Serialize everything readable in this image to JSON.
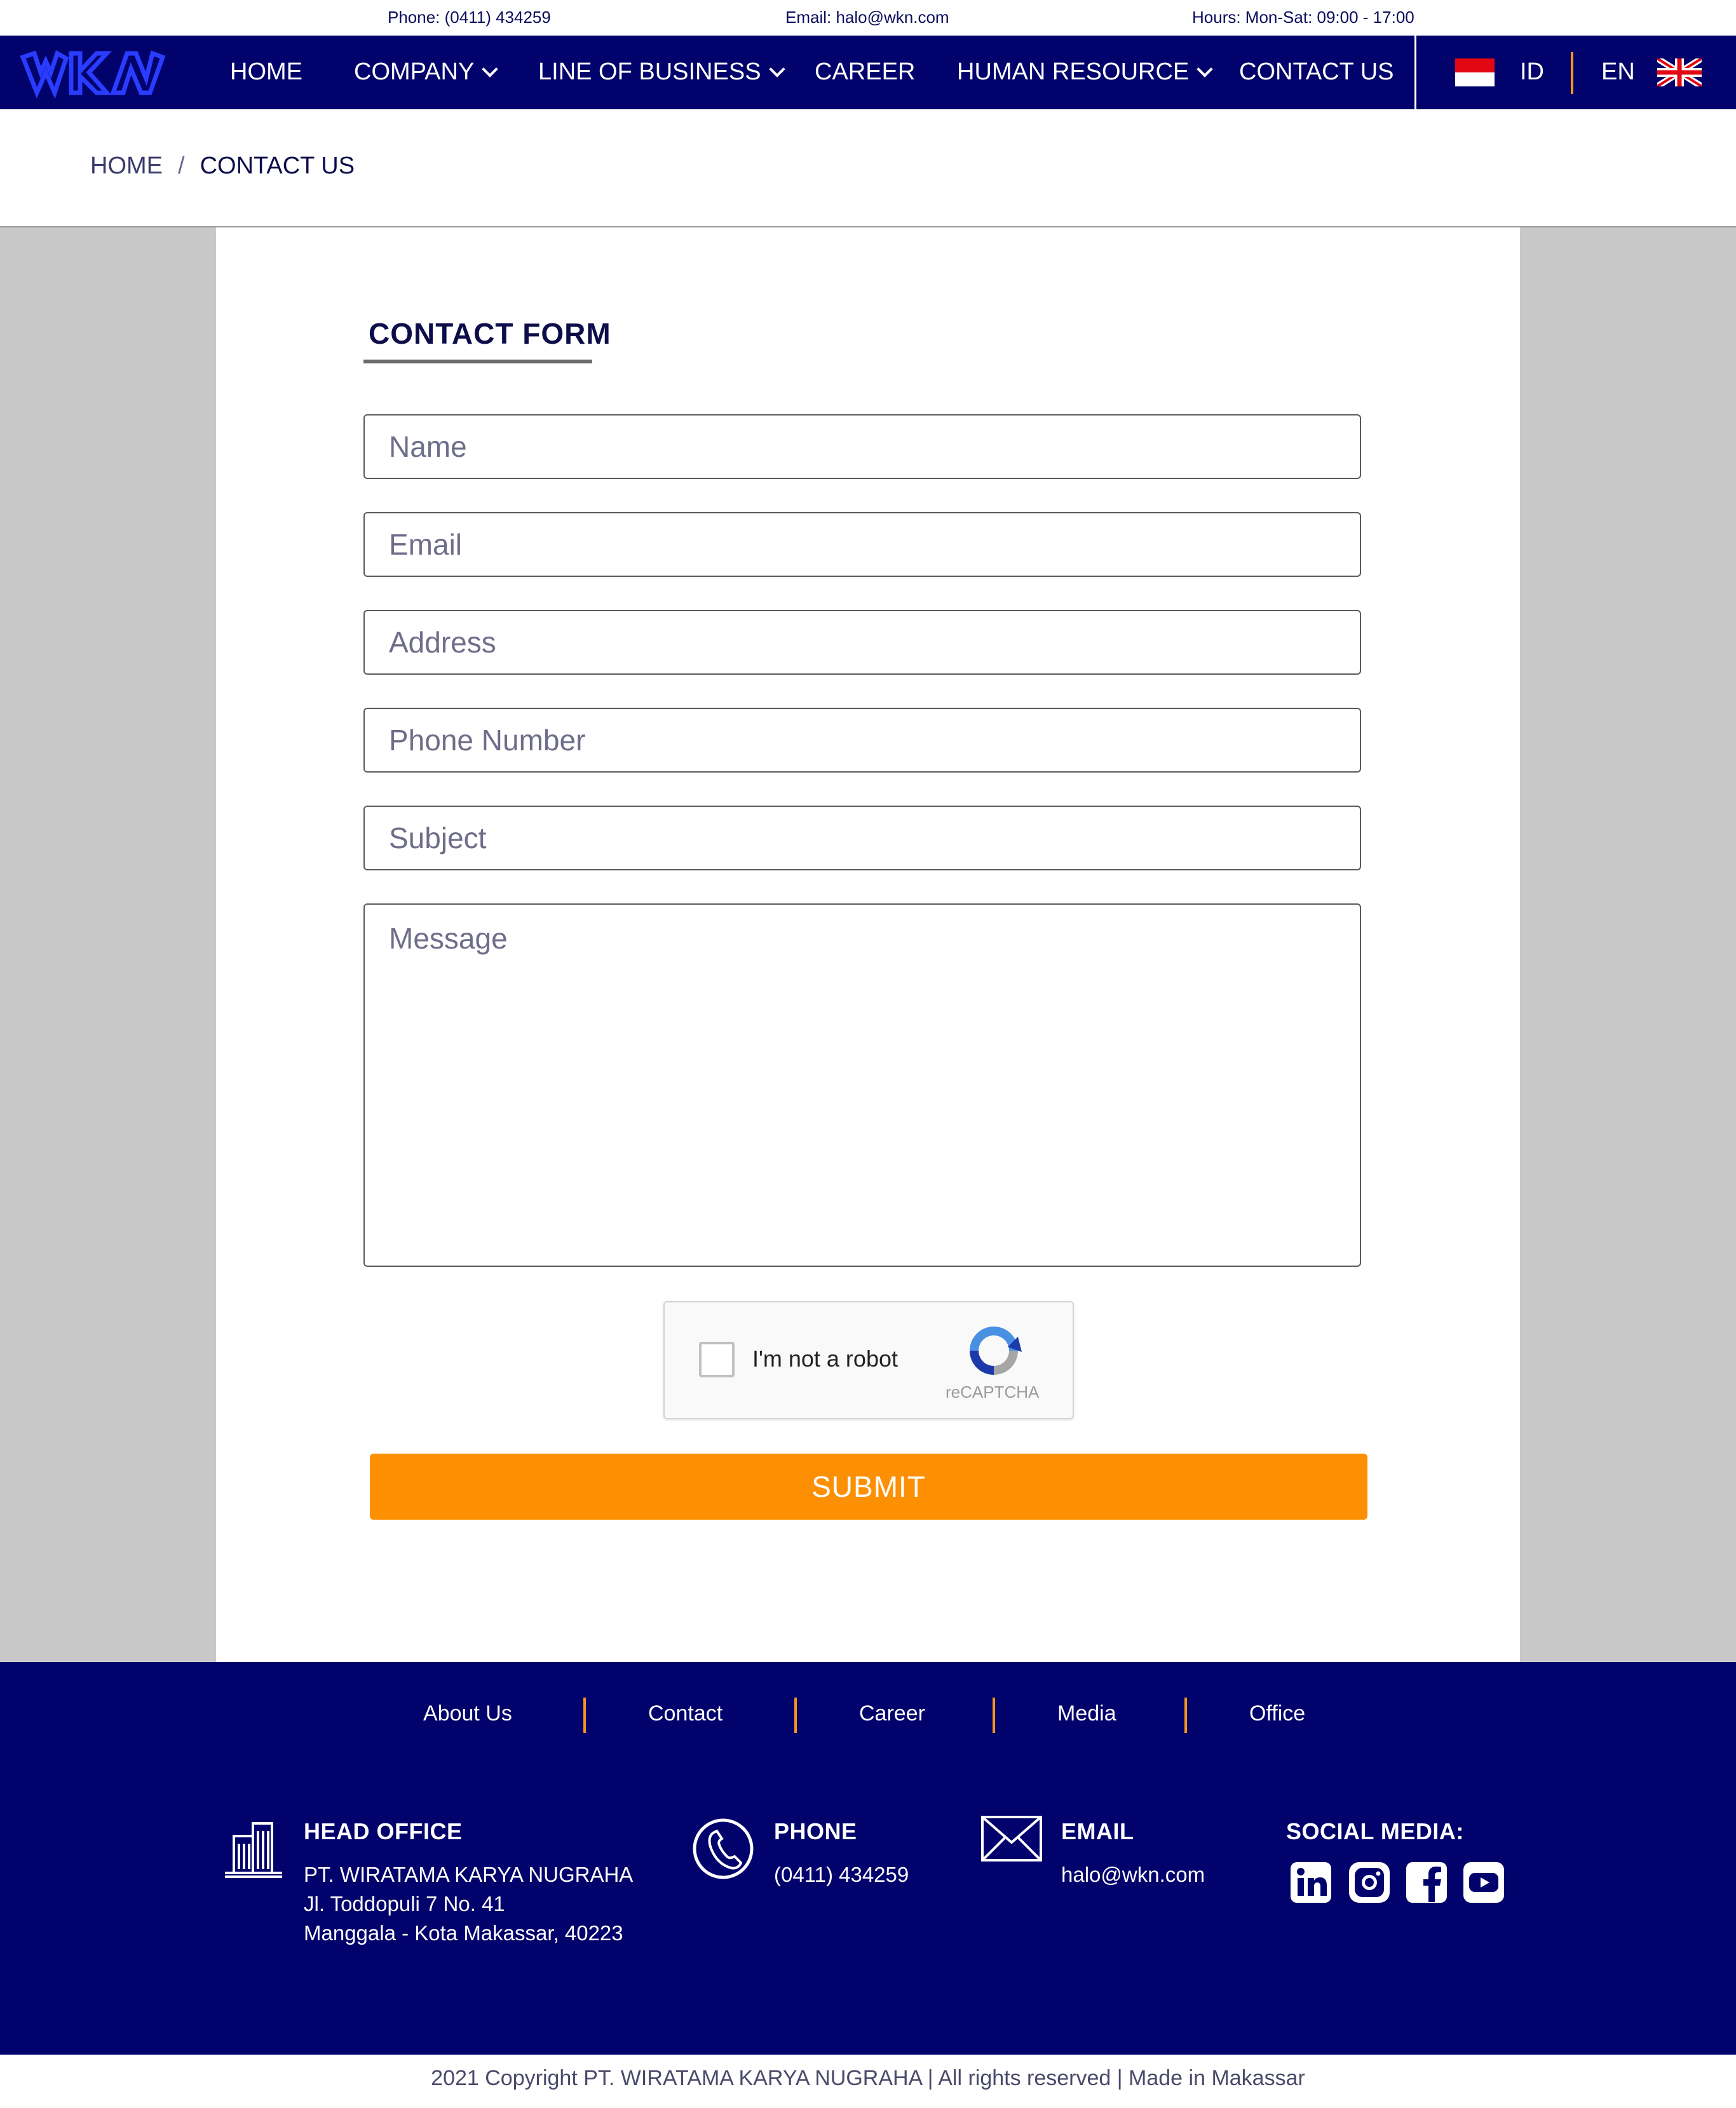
{
  "topbar": {
    "phone": "Phone: (0411) 434259",
    "email": "Email: halo@wkn.com",
    "hours": "Hours: Mon-Sat: 09:00 - 17:00"
  },
  "nav": {
    "items": [
      "HOME",
      "COMPANY",
      "LINE OF BUSINESS",
      "CAREER",
      "HUMAN RESOURCE",
      "CONTACT US"
    ],
    "lang_id": "ID",
    "lang_en": "EN"
  },
  "breadcrumb": {
    "home": "HOME",
    "separator": "/",
    "current": "CONTACT US"
  },
  "form": {
    "title": "CONTACT FORM",
    "name_placeholder": "Name",
    "email_placeholder": "Email",
    "address_placeholder": "Address",
    "phone_placeholder": "Phone Number",
    "subject_placeholder": "Subject",
    "message_placeholder": "Message",
    "captcha_label": "I'm not a robot",
    "captcha_brand": "reCAPTCHA",
    "submit_label": "SUBMIT"
  },
  "footer": {
    "links": [
      "About Us",
      "Contact",
      "Career",
      "Media",
      "Office"
    ],
    "head_office": {
      "title": "HEAD OFFICE",
      "line1": "PT. WIRATAMA KARYA NUGRAHA",
      "line2": "Jl. Toddopuli 7 No. 41",
      "line3": "Manggala - Kota Makassar, 40223"
    },
    "phone": {
      "title": "PHONE",
      "value": "(0411) 434259"
    },
    "email": {
      "title": "EMAIL",
      "value": "halo@wkn.com"
    },
    "social": {
      "title": "SOCIAL MEDIA:",
      "icons": [
        "linkedin-icon",
        "instagram-icon",
        "facebook-icon",
        "youtube-icon"
      ]
    }
  },
  "copyright": "2021 Copyright PT. WIRATAMA KARYA NUGRAHA |  All rights reserved | Made in Makassar",
  "colors": {
    "navy": "#01026b",
    "accent": "#fd9002",
    "grey": "#c8c8c8"
  }
}
